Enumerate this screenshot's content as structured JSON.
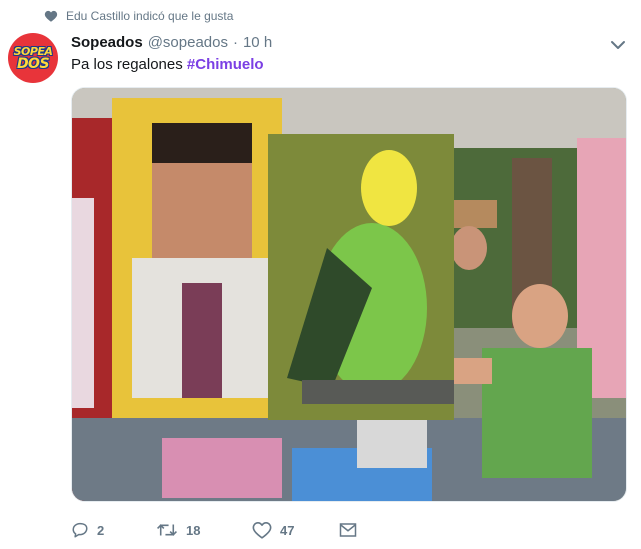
{
  "social_context": {
    "text": "Edu Castillo indicó que le gusta",
    "icon": "heart-icon"
  },
  "tweet": {
    "author_name": "Sopeados",
    "handle": "@sopeados",
    "separator": "·",
    "time": "10 h",
    "text_prefix": "Pa los regalones ",
    "hashtag": "#Chimuelo",
    "avatar": {
      "line1": "SOPEA",
      "line2": "DOS"
    }
  },
  "actions": {
    "reply_count": "2",
    "retweet_count": "18",
    "like_count": "47"
  },
  "colors": {
    "hashtag": "#7b3fe4",
    "secondary_text": "#657786",
    "avatar_bg": "#e8343a"
  }
}
